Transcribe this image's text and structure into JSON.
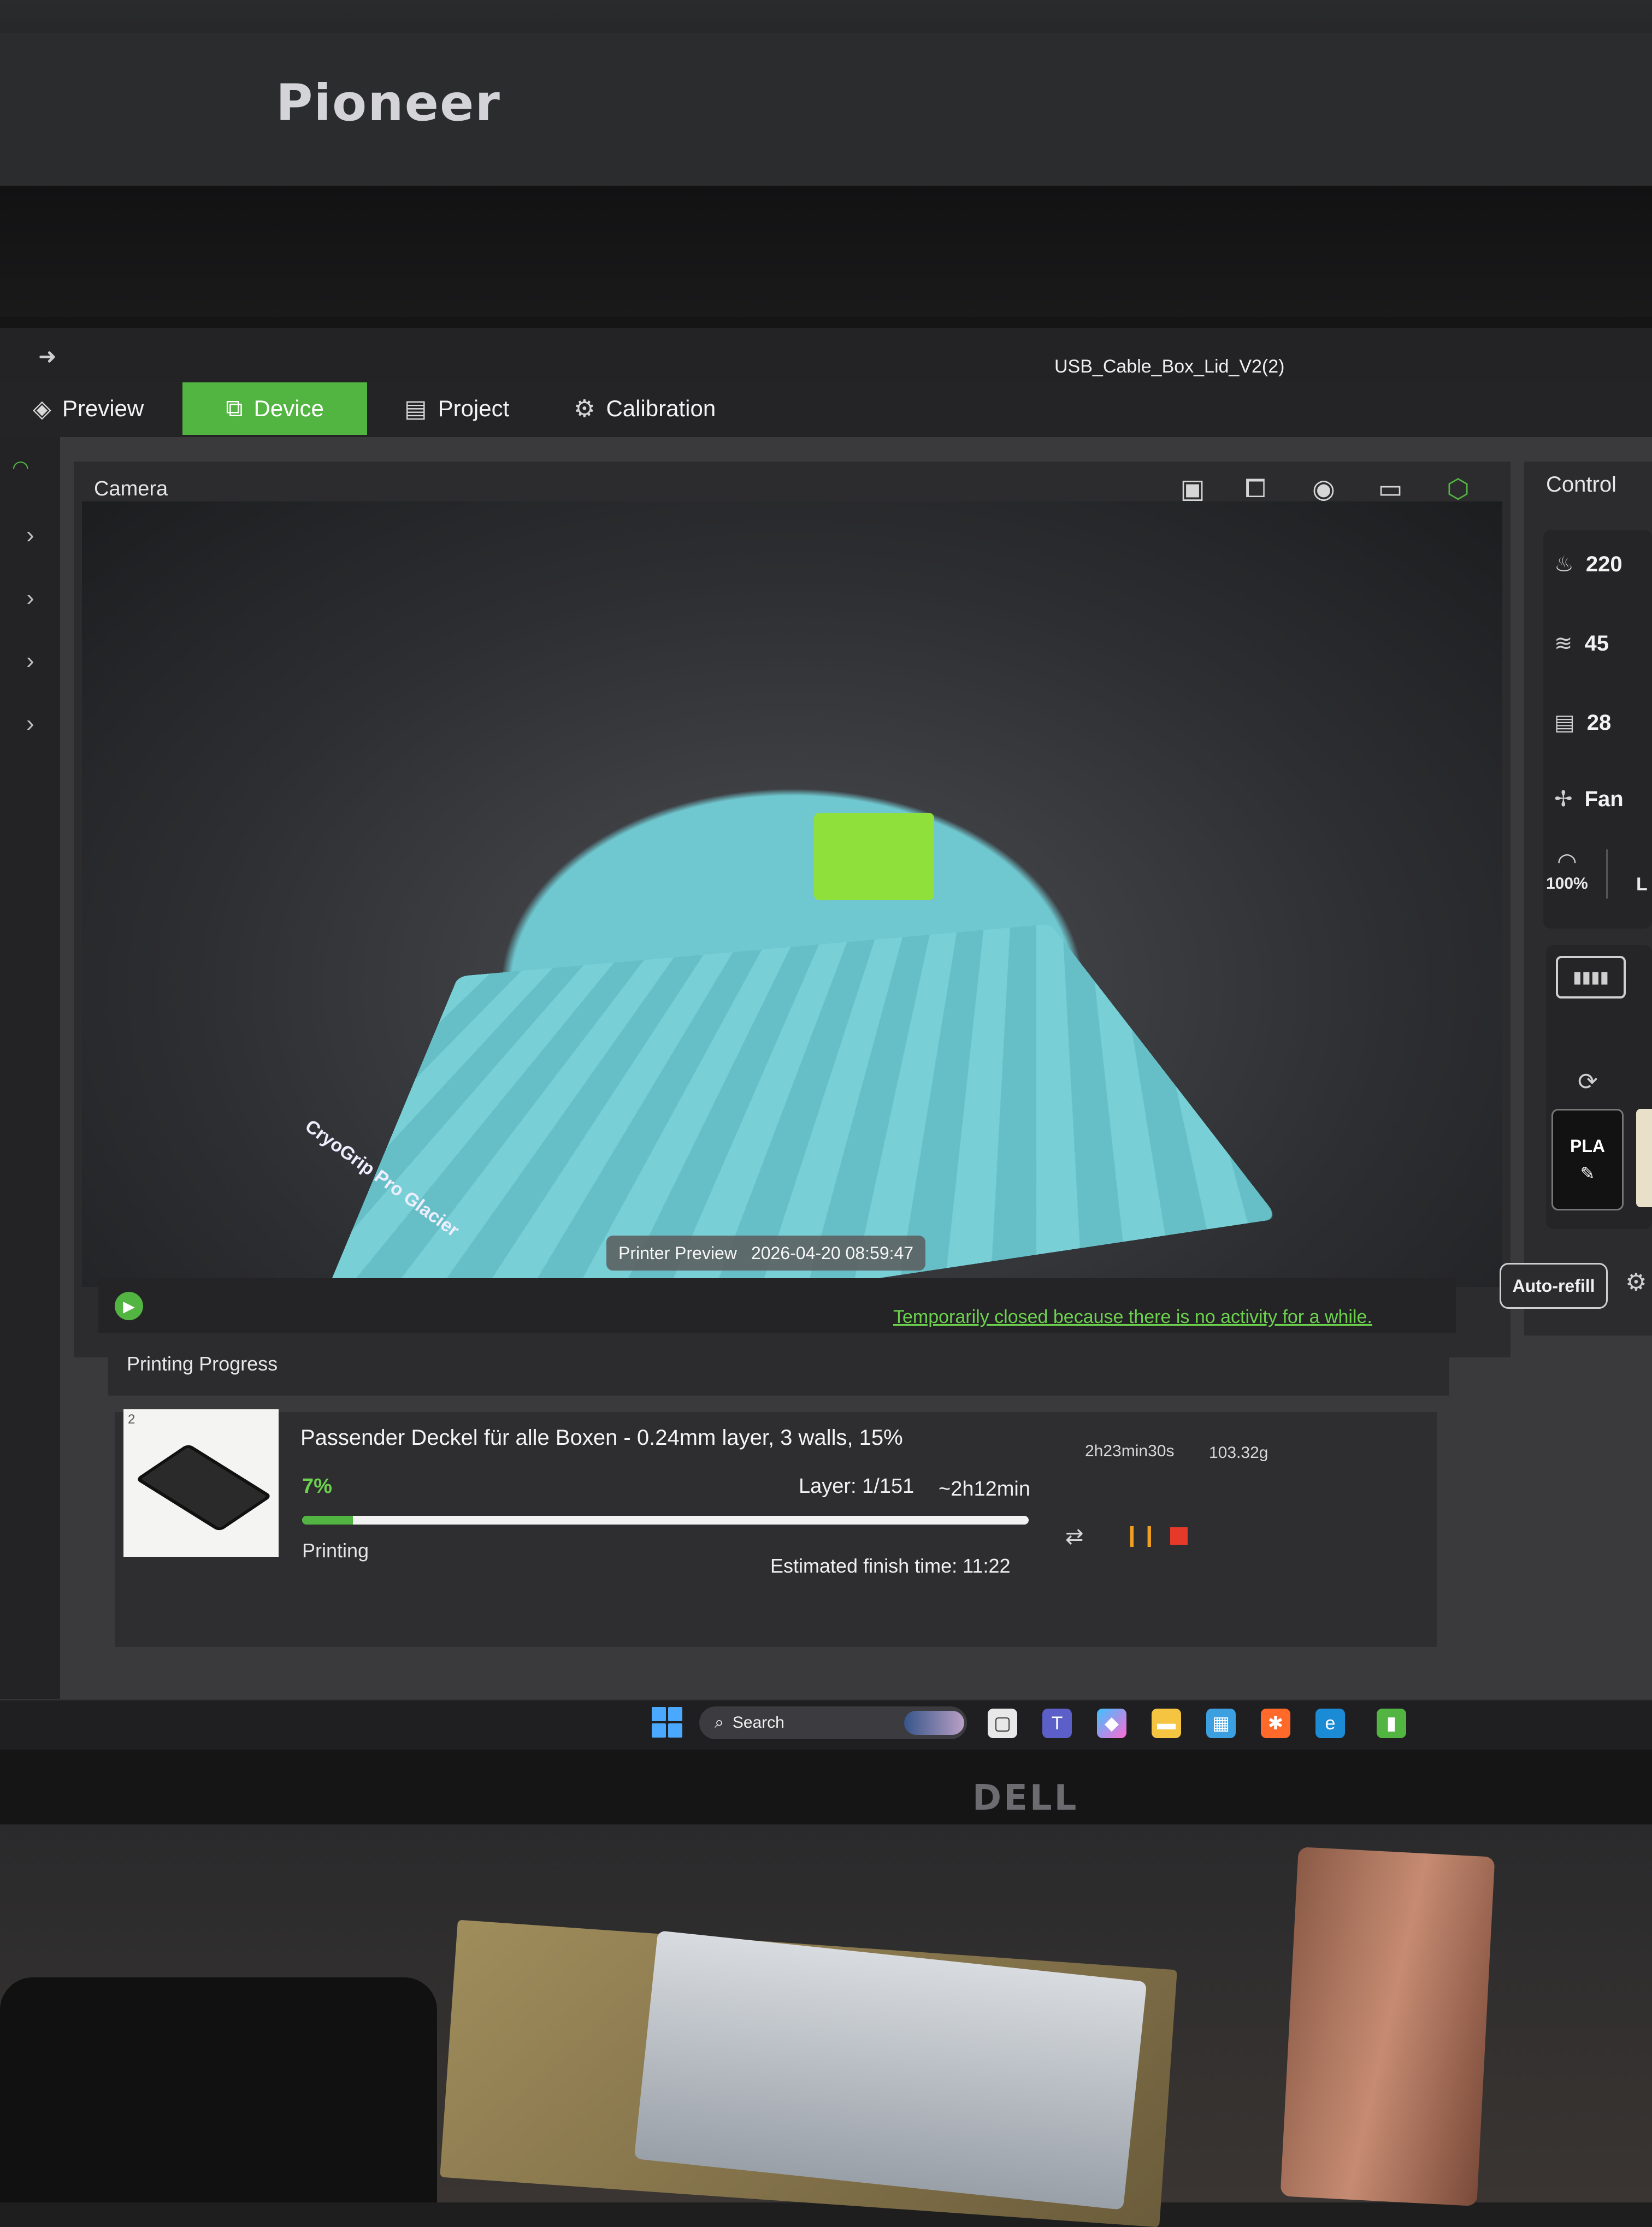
{
  "surroundings": {
    "upper_monitor_brand": "Pioneer",
    "monitor_brand": "DELL"
  },
  "window": {
    "title": "USB_Cable_Box_Lid_V2(2)"
  },
  "tabs": [
    {
      "label": "Preview",
      "icon": "layers-icon"
    },
    {
      "label": "Device",
      "icon": "device-icon",
      "active": true
    },
    {
      "label": "Project",
      "icon": "project-icon"
    },
    {
      "label": "Calibration",
      "icon": "calibration-icon"
    }
  ],
  "camera": {
    "title": "Camera",
    "tools": [
      "sd-card-icon",
      "camera-off-icon",
      "webcam-icon",
      "record-icon",
      "camera-settings-icon"
    ],
    "overlay_label": "Printer Preview",
    "overlay_timestamp": "2026-04-20 08:59:47",
    "plate_brand": "CryoGrip Pro Glacier",
    "inactive_message": "Temporarily closed because there is no activity for a while."
  },
  "control": {
    "title": "Control",
    "nozzle_temp": "220",
    "bed_temp": "45",
    "chamber_temp": "28",
    "fan_label": "Fan",
    "speed": "100%",
    "ams_slot_material": "PLA",
    "auto_refill_label": "Auto-refill"
  },
  "progress": {
    "title": "Printing Progress",
    "plate_number": "2",
    "job_name": "Passender Deckel für alle Boxen - 0.24mm layer, 3 walls, 15%",
    "duration": "2h23min30s",
    "weight": "103.32g",
    "percent_label": "7%",
    "percent": 0.07,
    "layer": "Layer: 1/151",
    "remaining": "~2h12min",
    "status": "Printing",
    "finish_time": "Estimated finish time: 11:22"
  },
  "taskbar": {
    "search_label": "Search",
    "apps": [
      "file-explorer-icon",
      "teams-icon",
      "copilot-icon",
      "folder-icon",
      "store-icon",
      "app-icon",
      "edge-icon",
      "bambu-studio-icon"
    ]
  },
  "colors": {
    "accent": "#52b441",
    "warning": "#f0a020",
    "danger": "#e53a2a"
  }
}
